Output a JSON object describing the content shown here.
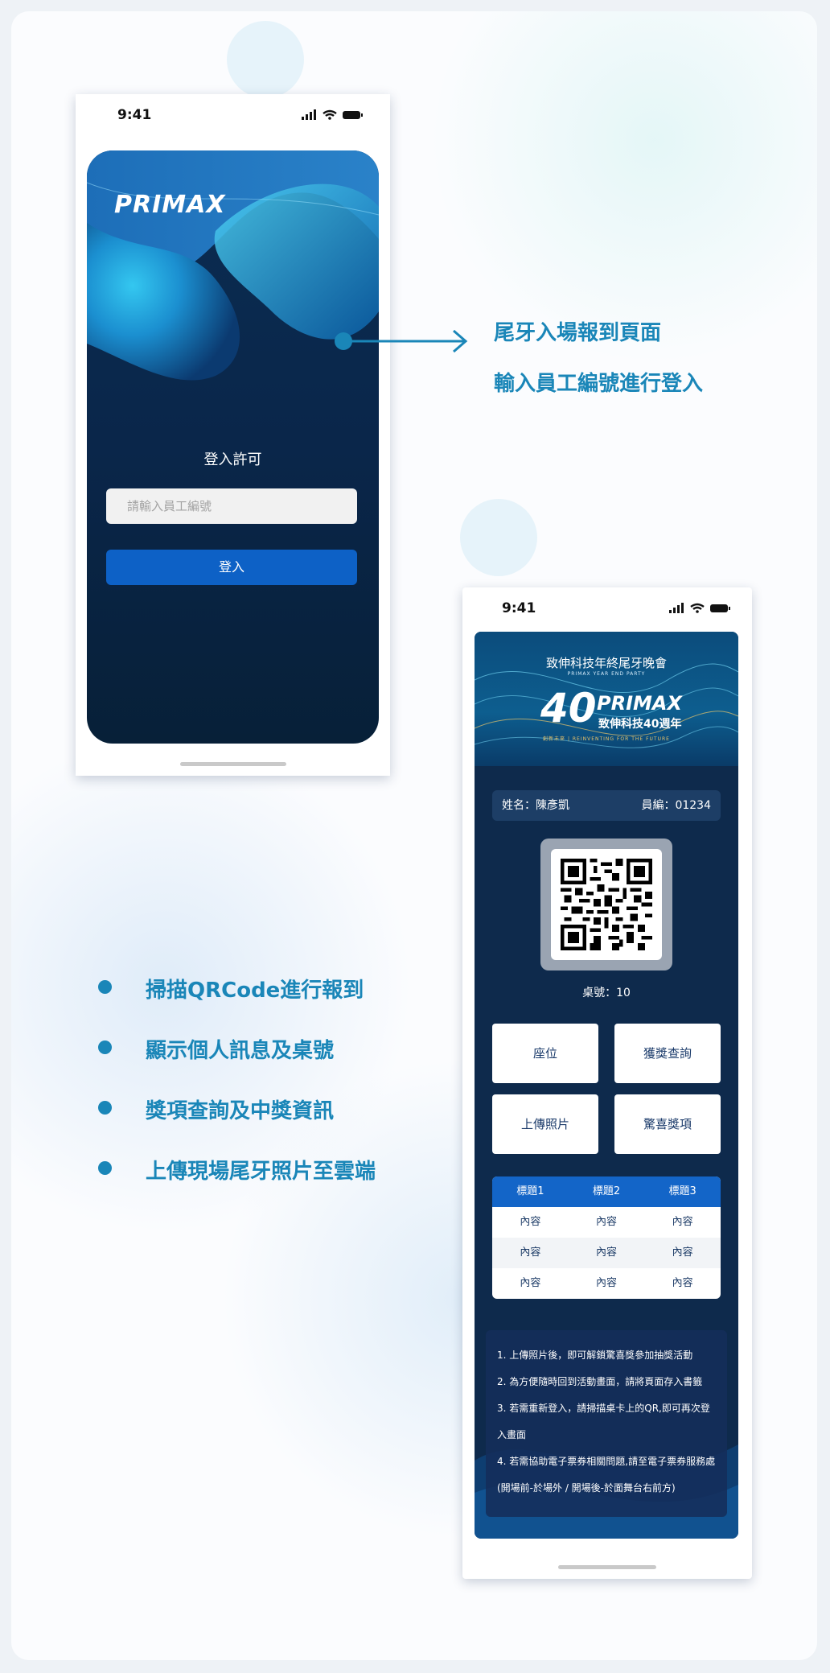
{
  "status": {
    "time": "9:41"
  },
  "login": {
    "logo_text": "PRIMAX",
    "title": "登入許可",
    "input_placeholder": "請輸入員工編號",
    "button_label": "登入"
  },
  "callout": {
    "line1": "尾牙入場報到頁面",
    "line2": "輸入員工編號進行登入"
  },
  "features": [
    "掃描QRCode進行報到",
    "顯示個人訊息及桌號",
    "獎項查詢及中獎資訊",
    "上傳現場尾牙照片至雲端"
  ],
  "party": {
    "banner_title": "致伸科技年終尾牙晚會",
    "banner_subtitle": "PRIMAX YEAR END PARTY",
    "banner_number": "40",
    "banner_logo": "PRIMAX",
    "banner_anniv": "致伸科技40週年",
    "banner_slogan": "創新未來 | REINVENTING FOR THE FUTURE",
    "name_label": "姓名：陳彥凱",
    "id_label": "員編：01234",
    "table_label": "桌號：10",
    "buttons": [
      "座位",
      "獲獎查詢",
      "上傳照片",
      "驚喜獎項"
    ],
    "table": {
      "headers": [
        "標題1",
        "標題2",
        "標題3"
      ],
      "rows": [
        [
          "內容",
          "內容",
          "內容"
        ],
        [
          "內容",
          "內容",
          "內容"
        ],
        [
          "內容",
          "內容",
          "內容"
        ]
      ]
    },
    "notes": [
      "1. 上傳照片後，即可解鎖驚喜獎參加抽獎活動",
      "2. 為方便隨時回到活動畫面，請將頁面存入書籤",
      "3. 若需重新登入，請掃描桌卡上的QR,即可再次登入畫面",
      "4. 若需協助電子票券相關問題,請至電子票券服務處(開場前-於場外 / 開場後-於面舞台右前方)"
    ]
  },
  "colors": {
    "accent": "#1a86b8",
    "login_button": "#0d61c6",
    "screen_dark": "#0e2a4c"
  }
}
